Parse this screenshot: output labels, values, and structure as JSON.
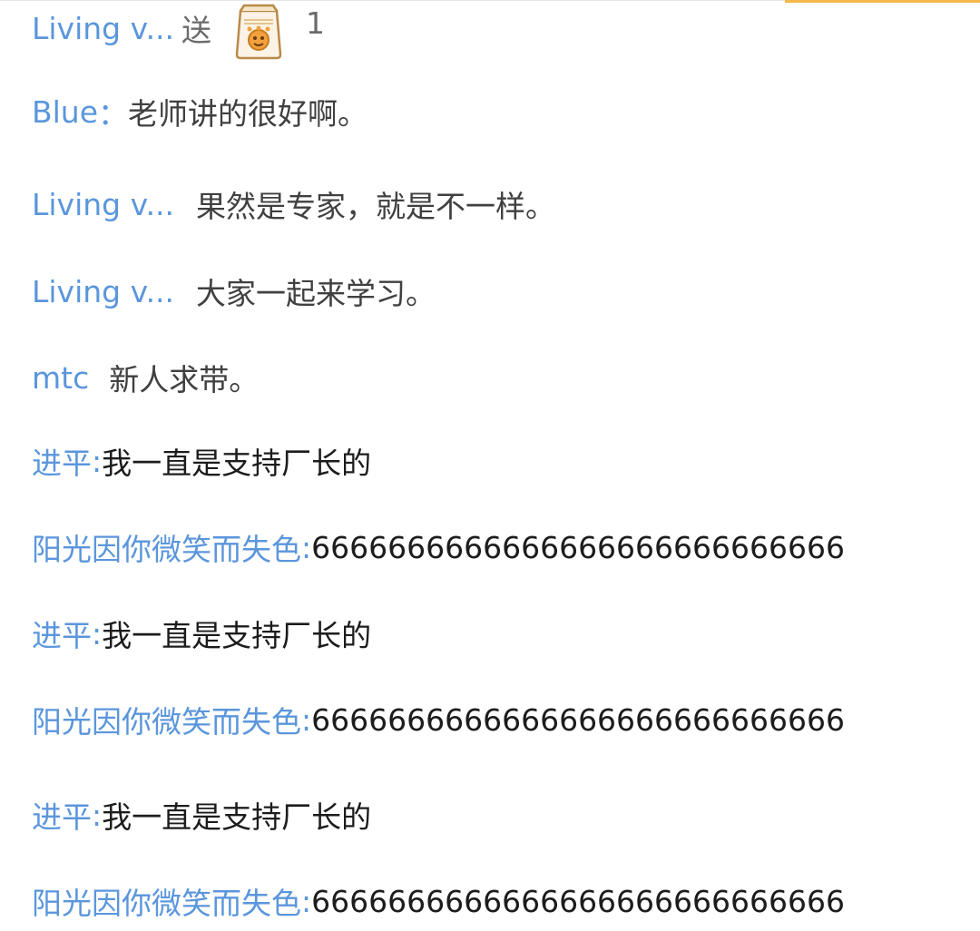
{
  "chat": {
    "gift": {
      "user": "Living v...",
      "verb": "送",
      "icon": "snack-bag-icon",
      "count": "1"
    },
    "messages": [
      {
        "user": "Blue",
        "sep": "：",
        "text": "老师讲的很好啊。"
      },
      {
        "user": "Living v...",
        "sep": "",
        "text": "果然是专家，就是不一样。"
      },
      {
        "user": "Living v...",
        "sep": "",
        "text": "大家一起来学习。"
      },
      {
        "user": "mtc",
        "sep": "",
        "text": "新人求带。"
      },
      {
        "user": "进平",
        "sep": ":",
        "text": "我一直是支持厂长的"
      },
      {
        "user": "阳光因你微笑而失色",
        "sep": ":",
        "text": "6666666666666666666666666666"
      },
      {
        "user": "进平",
        "sep": ":",
        "text": "我一直是支持厂长的"
      },
      {
        "user": "阳光因你微笑而失色",
        "sep": ":",
        "text": "6666666666666666666666666666"
      },
      {
        "user": "进平",
        "sep": ":",
        "text": "我一直是支持厂长的"
      },
      {
        "user": "阳光因你微笑而失色",
        "sep": ":",
        "text": "6666666666666666666666666666"
      }
    ]
  },
  "colors": {
    "username": "#5b96dc",
    "text": "#333333",
    "accent": "#f3b94a"
  }
}
